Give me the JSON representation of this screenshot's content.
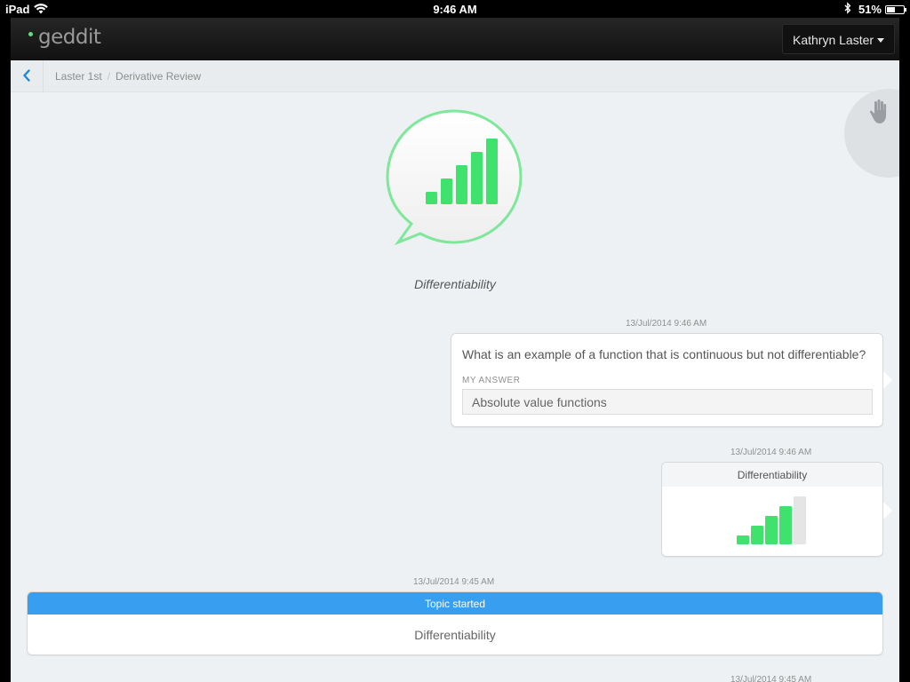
{
  "status_bar": {
    "carrier": "iPad",
    "time": "9:46 AM",
    "battery_percent": "51%",
    "battery_level": 0.51,
    "icons": [
      "wifi-icon",
      "bluetooth-icon",
      "battery-icon"
    ]
  },
  "header": {
    "logo": "geddit",
    "logo_dot_color": "#5ee07d",
    "user_name": "Kathryn Laster"
  },
  "breadcrumb": {
    "back_icon": "chevron-left-icon",
    "items": [
      "Laster 1st",
      "Derivative Review"
    ],
    "separator": "/"
  },
  "raise_hand_icon": "raised-hand-icon",
  "topic": {
    "title": "Differentiability",
    "icon": "speech-bubble-signal-icon",
    "rating_bars_filled": 5,
    "rating_bars_total": 5,
    "accent_color": "#3ee26c"
  },
  "feed": [
    {
      "type": "question",
      "timestamp": "13/Jul/2014 9:46 AM",
      "question": "What is an example of a function that is continuous but not differentiable?",
      "answer_label": "MY ANSWER",
      "answer": "Absolute value functions"
    },
    {
      "type": "rating",
      "timestamp": "13/Jul/2014 9:46 AM",
      "title": "Differentiability",
      "bars_filled": 4,
      "bars_total": 5
    },
    {
      "type": "topic_started",
      "timestamp": "13/Jul/2014 9:45 AM",
      "header": "Topic started",
      "title": "Differentiability",
      "header_color": "#389ff0"
    },
    {
      "type": "partial",
      "timestamp": "13/Jul/2014 9:45 AM"
    }
  ]
}
